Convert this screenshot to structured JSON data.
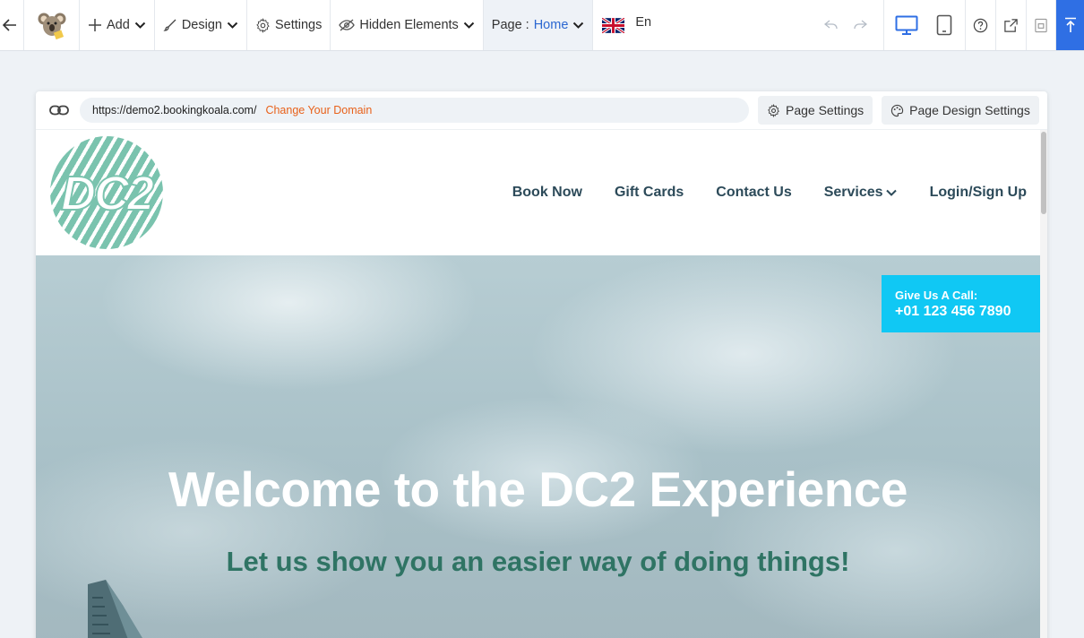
{
  "toolbar": {
    "add_label": "Add",
    "design_label": "Design",
    "settings_label": "Settings",
    "hidden_label": "Hidden Elements",
    "page_prefix": "Page :",
    "page_value": "Home",
    "lang_label": "En"
  },
  "urlbar": {
    "url": "https://demo2.bookingkoala.com/",
    "change_domain": "Change Your Domain",
    "page_settings": "Page Settings",
    "page_design_settings": "Page Design Settings"
  },
  "site": {
    "logo_text": "DC2",
    "nav": [
      "Book Now",
      "Gift Cards",
      "Contact Us",
      "Services",
      "Login/Sign Up"
    ],
    "call_label": "Give Us A Call:",
    "call_number": "+01 123 456 7890",
    "hero_title": "Welcome to the DC2 Experience",
    "hero_subtitle": "Let us show you an easier way of doing things!"
  },
  "colors": {
    "accent": "#2f6fe4",
    "link_orange": "#e8611a",
    "call_cyan": "#10c8f4",
    "subtitle_green": "#2f7464"
  }
}
